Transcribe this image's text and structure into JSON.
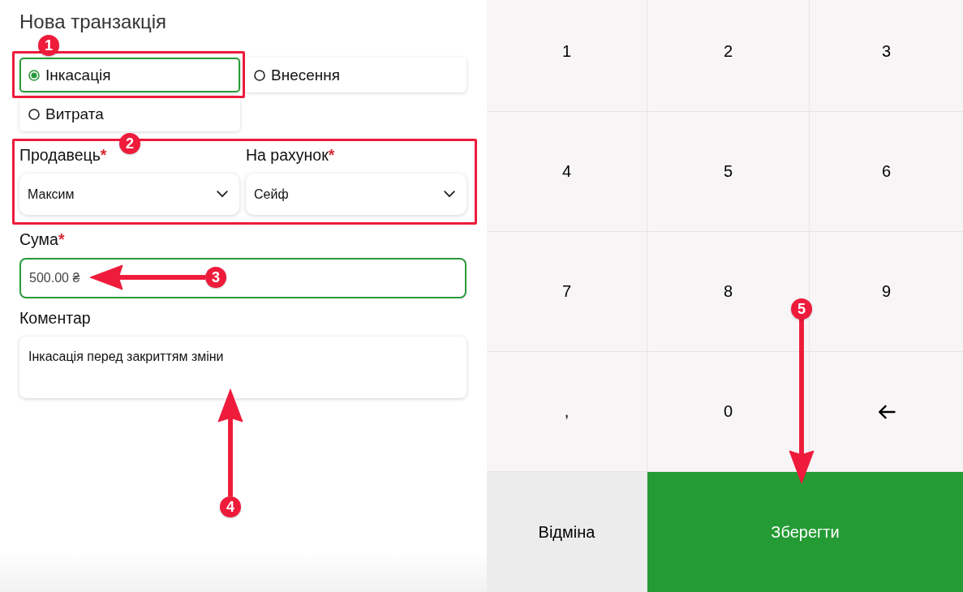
{
  "form": {
    "title": "Нова транзакція",
    "transaction_types": [
      {
        "label": "Інкасація",
        "selected": true
      },
      {
        "label": "Внесення",
        "selected": false
      },
      {
        "label": "Витрата",
        "selected": false
      }
    ],
    "seller": {
      "label": "Продавець",
      "required_mark": "*",
      "value": "Максим"
    },
    "account": {
      "label": "На рахунок",
      "required_mark": "*",
      "value": "Сейф"
    },
    "amount": {
      "label": "Сума",
      "required_mark": "*",
      "value": "500.00 ₴"
    },
    "comment": {
      "label": "Коментар",
      "value": "Інкасація перед закриттям зміни"
    }
  },
  "keypad": {
    "keys": [
      {
        "kind": "char",
        "label": "1"
      },
      {
        "kind": "char",
        "label": "2"
      },
      {
        "kind": "char",
        "label": "3"
      },
      {
        "kind": "char",
        "label": "4"
      },
      {
        "kind": "char",
        "label": "5"
      },
      {
        "kind": "char",
        "label": "6"
      },
      {
        "kind": "char",
        "label": "7"
      },
      {
        "kind": "char",
        "label": "8"
      },
      {
        "kind": "char",
        "label": "9"
      },
      {
        "kind": "char",
        "label": ","
      },
      {
        "kind": "char",
        "label": "0"
      },
      {
        "kind": "backspace"
      }
    ],
    "actions": [
      {
        "kind": "cancel",
        "label": "Відміна"
      },
      {
        "kind": "save",
        "label": "Зберегти"
      }
    ]
  },
  "annotations": [
    {
      "kind": "box",
      "label": "1"
    },
    {
      "kind": "box",
      "label": "2"
    },
    {
      "kind": "arrow",
      "label": "3"
    },
    {
      "kind": "arrow",
      "label": "4"
    },
    {
      "kind": "arrow",
      "label": "5"
    }
  ]
}
